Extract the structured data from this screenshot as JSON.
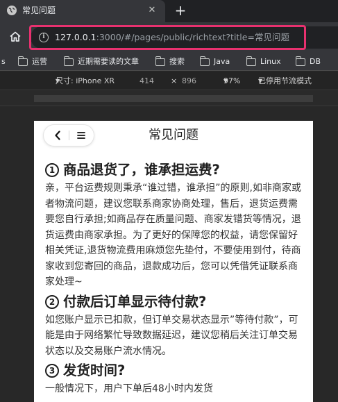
{
  "browser": {
    "tab_title": "常见问题",
    "new_tab_symbol": "+",
    "close_symbol": "✕",
    "url_host": "127.0.0.1",
    "url_rest": ":3000/#/pages/public/richtext?title=常见问题"
  },
  "bookmarks": [
    {
      "label": "s",
      "has_folder": false
    },
    {
      "label": "运营",
      "has_folder": true
    },
    {
      "label": "近期需要读的文章",
      "has_folder": true
    },
    {
      "label": "搜索",
      "has_folder": true
    },
    {
      "label": "Java",
      "has_folder": true
    },
    {
      "label": "Linux",
      "has_folder": true
    },
    {
      "label": "DB",
      "has_folder": true
    }
  ],
  "device_toolbar": {
    "size_label": "尺寸: iPhone XR",
    "width": "414",
    "times": "×",
    "height": "896",
    "zoom": "97%",
    "throttle": "已停用节流模式"
  },
  "page": {
    "title": "常见问题",
    "faqs": [
      {
        "num": "1",
        "question": "商品退货了，谁承担运费?",
        "answer": "亲，平台运费规则秉承“谁过错，谁承担”的原则,如非商家或者物流问题，建议您联系商家协商处理，售后，退货运费需要您自行承担;如商品存在质量问题、商家发错货等情况，退货运费由商家承担。为了更好的保障您的权益，请您保留好相关凭证,退货物流费用麻烦您先垫付，不要使用到付，待商家收到您寄回的商品，退款成功后，您可以凭借凭证联系商家处理~"
      },
      {
        "num": "2",
        "question": "付款后订单显示待付款?",
        "answer": "如您账户显示已扣款，但订单交易状态显示”等待付款”，可能是由于网络繁忙导致数据延迟，建议您稍后关注订单交易状态以及交易账户流水情况。"
      },
      {
        "num": "3",
        "question": "发货时间?",
        "answer": "一般情况下，用户下单后48小时内发货"
      }
    ]
  }
}
